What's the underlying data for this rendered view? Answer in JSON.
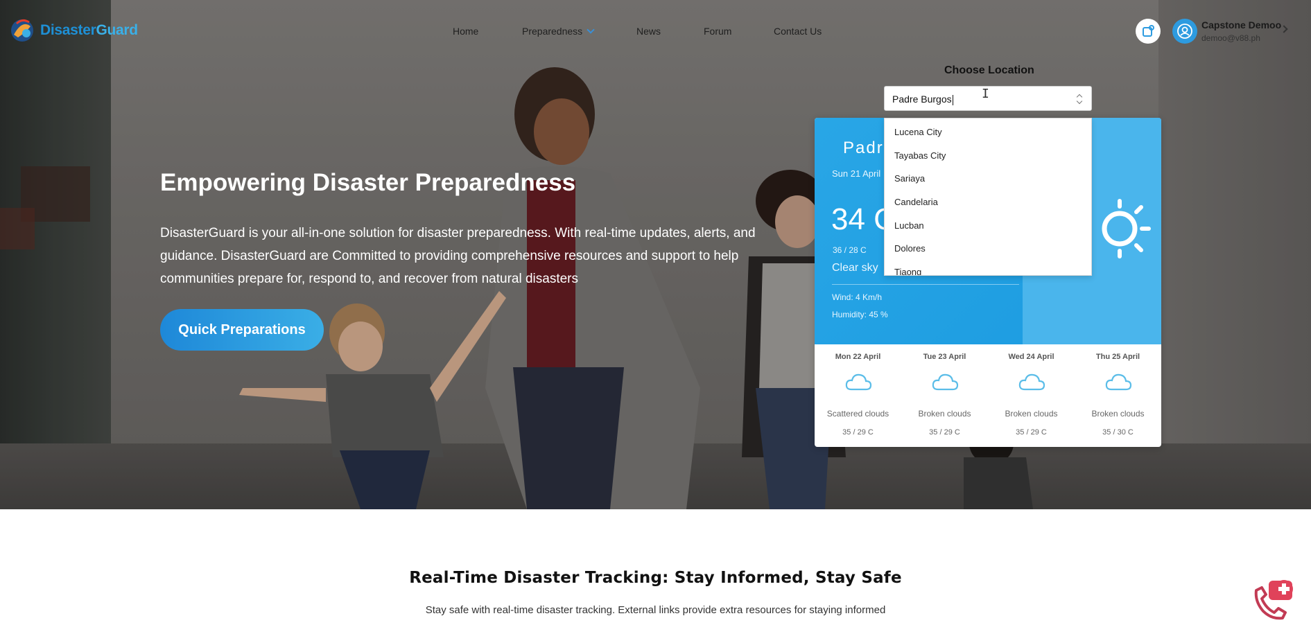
{
  "brand": {
    "name_part1": "Disaster",
    "name_part2": "Guard"
  },
  "nav": {
    "items": [
      "Home",
      "Preparedness",
      "News",
      "Forum",
      "Contact Us"
    ]
  },
  "user": {
    "name": "Capstone Demoo",
    "email": "demoo@v88.ph"
  },
  "hero": {
    "title": "Empowering Disaster Preparedness",
    "description": "DisasterGuard is your all-in-one solution for disaster preparedness. With real-time updates, alerts, and guidance. DisasterGuard are Committed to providing comprehensive resources and support to help communities prepare for, respond to, and recover from natural disasters",
    "cta": "Quick Preparations"
  },
  "location": {
    "label": "Choose Location",
    "value": "Padre Burgos",
    "options": [
      "Lucena City",
      "Tayabas City",
      "Sariaya",
      "Candelaria",
      "Lucban",
      "Dolores",
      "Tiaong"
    ]
  },
  "weather": {
    "city": "Padr",
    "date": "Sun 21 April",
    "temp": "34 C",
    "range": "36 / 28 C",
    "condition": "Clear sky",
    "wind": "Wind: 4 Km/h",
    "humidity": "Humidity: 45 %",
    "forecast": [
      {
        "date": "Mon 22 April",
        "desc": "Scattered clouds",
        "range": "35 / 29 C"
      },
      {
        "date": "Tue 23 April",
        "desc": "Broken clouds",
        "range": "35 / 29 C"
      },
      {
        "date": "Wed 24 April",
        "desc": "Broken clouds",
        "range": "35 / 29 C"
      },
      {
        "date": "Thu 25 April",
        "desc": "Broken clouds",
        "range": "35 / 30 C"
      }
    ]
  },
  "tracking": {
    "title": "Real-Time Disaster Tracking: Stay Informed, Stay Safe",
    "subtitle": "Stay safe with real-time disaster tracking. External links provide extra resources for staying informed"
  },
  "colors": {
    "brand_blue": "#1e90d6",
    "card_blue": "#29a6e6",
    "cloud_blue": "#5bbde8",
    "help_red": "#e0425a"
  },
  "icons": [
    "logo-icon",
    "chevron-down-icon",
    "notification-icon",
    "user-icon",
    "chevron-right-icon",
    "sun-icon",
    "cloud-icon",
    "help-phone-icon",
    "select-caret-icon"
  ]
}
